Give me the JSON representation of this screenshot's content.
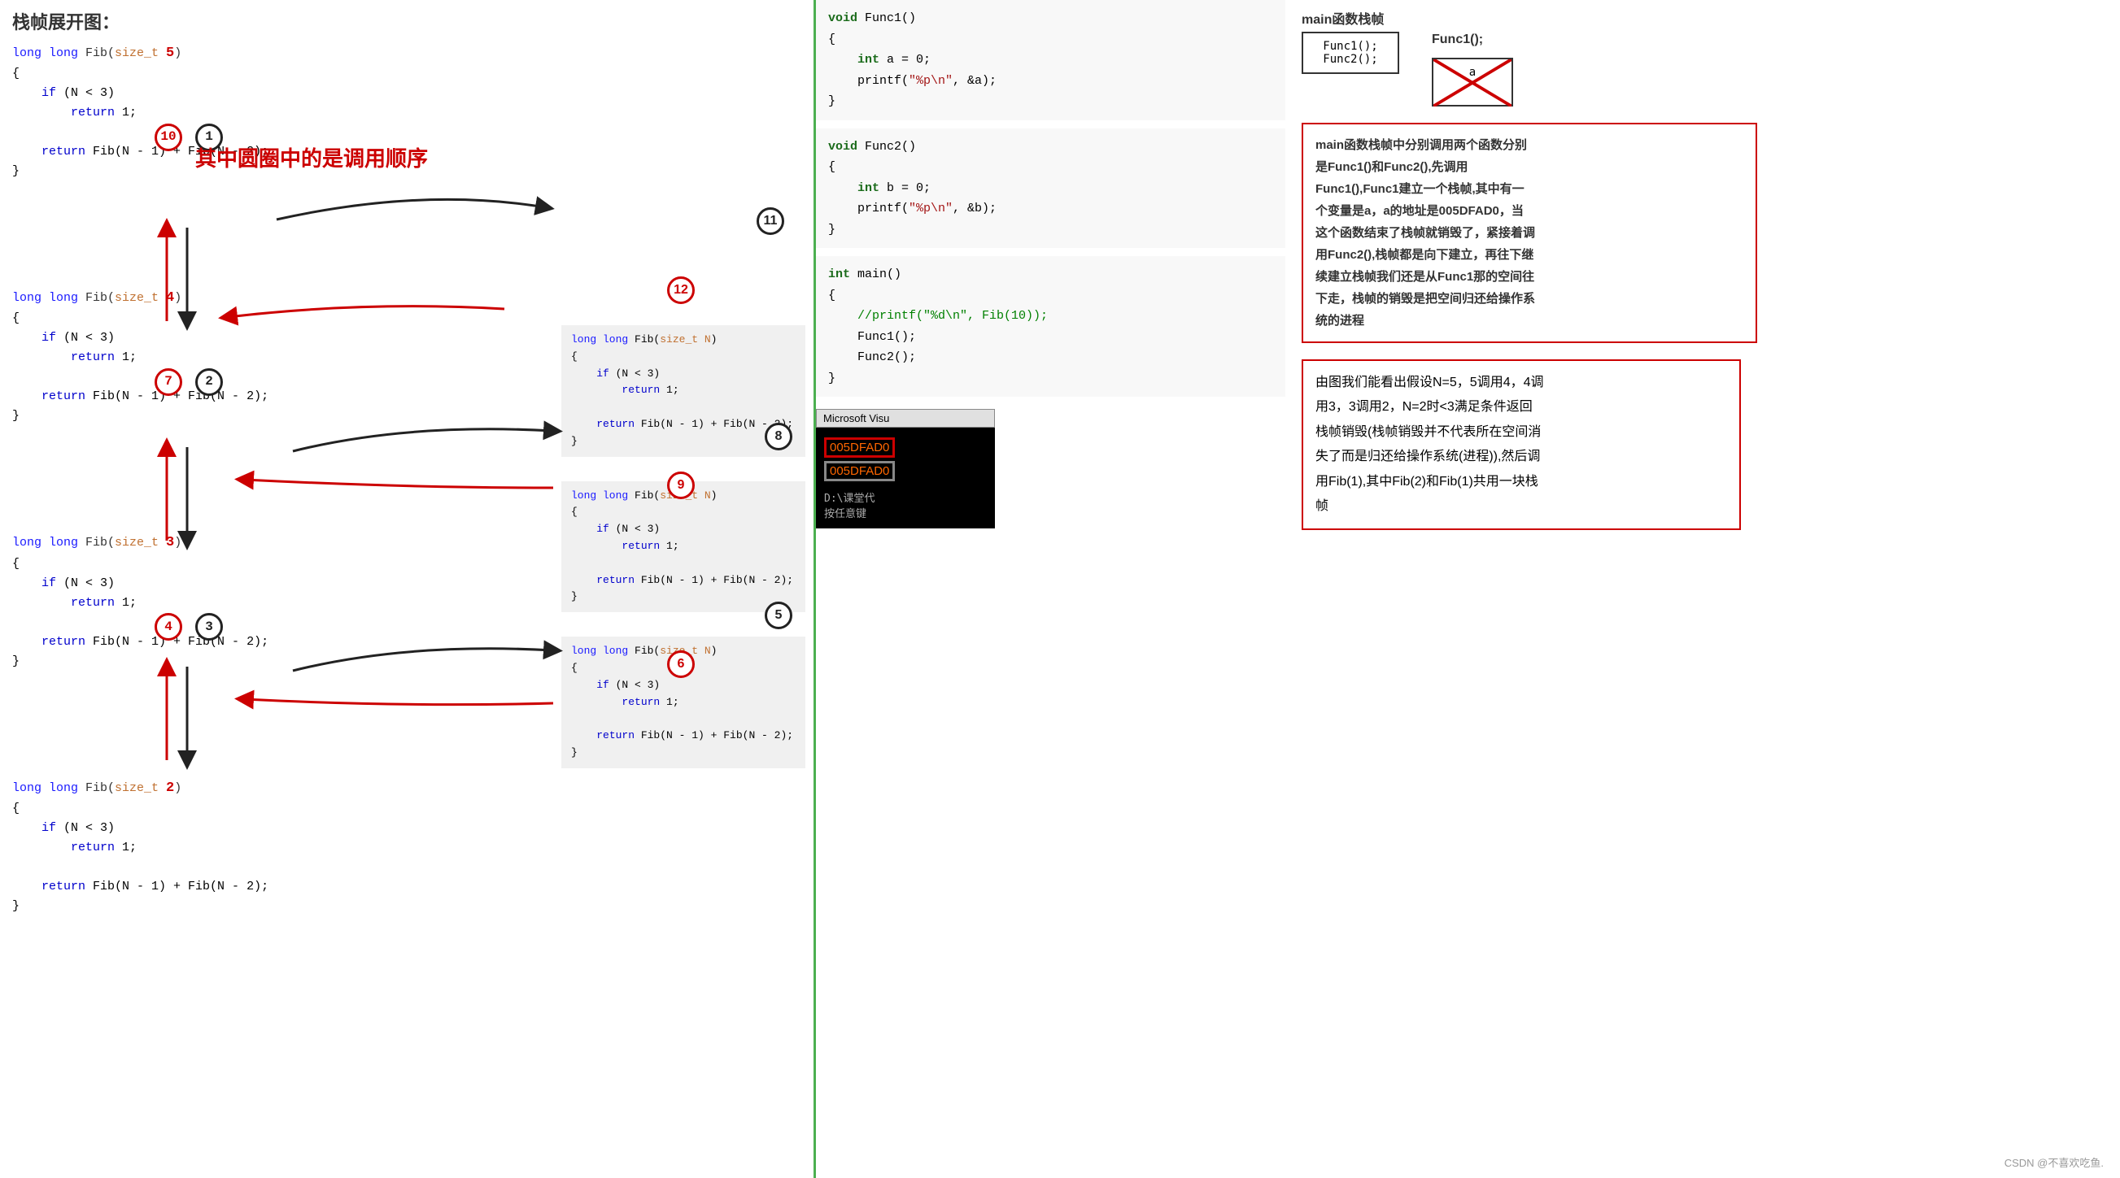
{
  "title": "栈帧展开图：",
  "bold_red_text": "其中圆圈中的是调用顺序",
  "watermark": "CSDN @不喜欢吃鱼.",
  "code_blocks": {
    "fib5_header": "long long Fib(size_t ",
    "fib5_n": "5",
    "fib5_body": [
      "{\n    if (N < 3)\n        return 1;\n\n    return Fib(N - 1) + Fib(N - 2);\n}"
    ],
    "fib4_header": "long long Fib(size_t ",
    "fib4_n": "4",
    "fib3_header": "long long Fib(size_t ",
    "fib3_n": "3",
    "fib2_header": "long long Fib(size_t ",
    "fib2_n": "2"
  },
  "middle_code": {
    "func1": "void Func1()\n{\n    int a = 0;\n    printf(\"%p\\n\", &a);\n}",
    "func2": "void Func2()\n{\n    int b = 0;\n    printf(\"%p\\n\", &b);\n}",
    "main": "int main()\n{\n    //printf(\"%d\\n\", Fib(10));\n    Func1();\n    Func2();\n}"
  },
  "terminal": {
    "title": "Microsoft Visu",
    "addr1": "005DFAD0",
    "addr2": "005DFAD0",
    "text": "D:\\课堂代\n按任意键"
  },
  "right": {
    "main_stack_label": "main函数栈帧",
    "func1_box": "Func1();\nFunc2();",
    "func1_label": "Func1();",
    "func1_frame_box": "a",
    "info1": "main函数栈帧中分别调用两个函数分别是Func1()和Func2(),先调用Func1(),Func1建立一个栈帧,其中有一个变量是a，a的地址是005DFAD0，当这个函数结束了栈帧就销毁了，紧接着调用Func2(),栈帧都是向下建立，再往下继续建立栈帧我们还是从Func1那的空间往下走，栈帧的销毁是把空间归还给操作系统的进程",
    "info2": "由图我们能看出假设N=5，5调用4，4调用3，3调用2，N=2时<3满足条件返回栈帧销毁(栈帧销毁并不代表所在空间消失了而是归还给操作系统(进程)),然后调用Fib(1),其中Fib(2)和Fib(1)共用一块栈帧"
  },
  "sub_codes": {
    "block1": "long long Fib(size_t N)\n{\n    if (N < 3)\n        return 1;\n\n    return Fib(N - 1) + Fib(N - 2);\n}",
    "block2": "long long Fib(size_t N)\n{\n    if (N < 3)\n        return 1;\n\n    return Fib(N - 1) + Fib(N - 2);\n}",
    "block3": "long long Fib(size_t N)\n{\n    if (N < 3)\n        return 1;\n\n    return Fib(N - 1) + Fib(N - 2);\n}"
  },
  "circle_numbers": {
    "n1": "1",
    "n2": "2",
    "n3": "3",
    "n4": "4",
    "n5": "5",
    "n6": "6",
    "n7": "7",
    "n8": "8",
    "n9": "9",
    "n10": "10",
    "n11": "11",
    "n12": "12"
  },
  "int_keyword": "int"
}
